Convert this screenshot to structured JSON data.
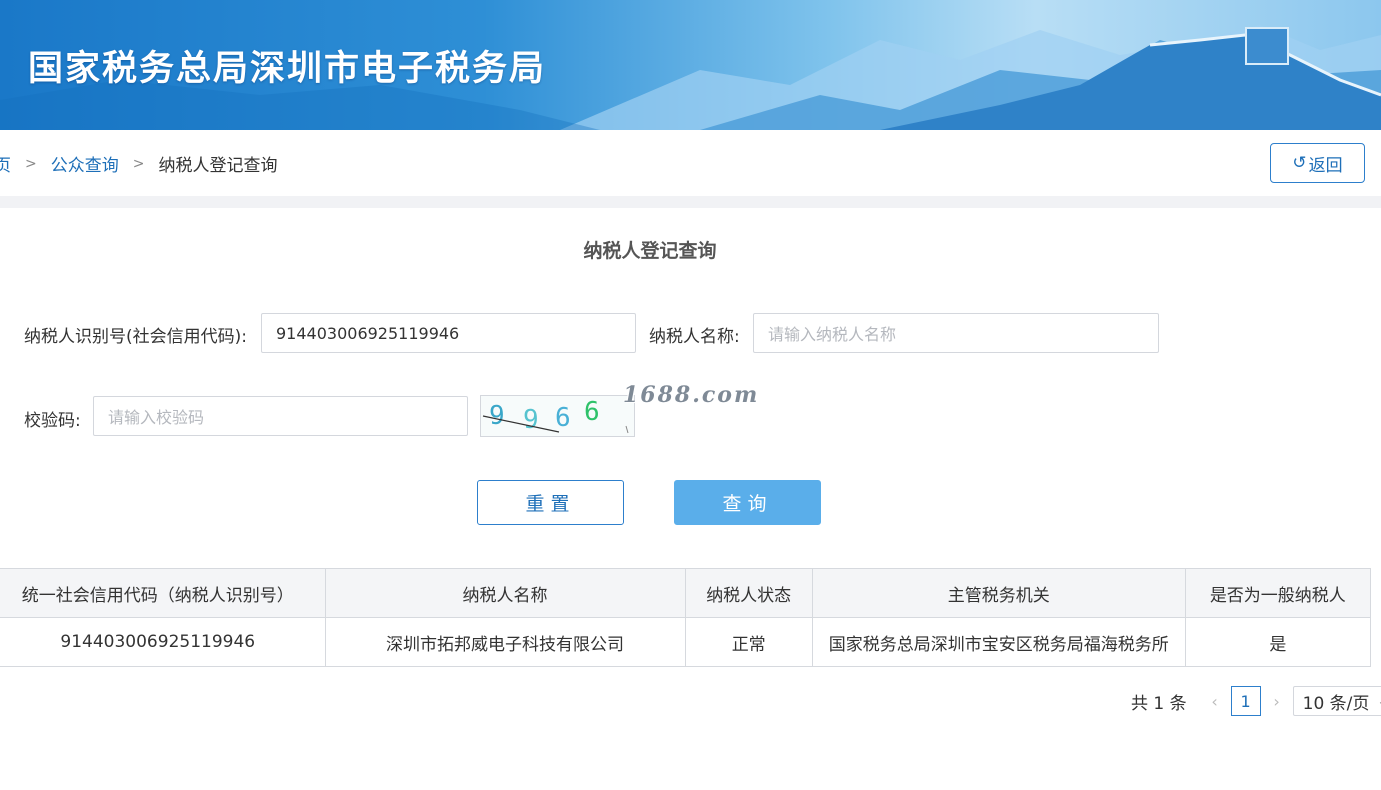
{
  "header": {
    "title": "国家税务总局深圳市电子税务局"
  },
  "breadcrumb": {
    "home": "页",
    "public_query": "公众查询",
    "current": "纳税人登记查询",
    "separator": ">"
  },
  "back_button": {
    "icon": "undo-arrow-icon",
    "icon_glyph": "↺",
    "label": "返回"
  },
  "form": {
    "title": "纳税人登记查询",
    "taxpayer_id_label": "纳税人识别号(社会信用代码):",
    "taxpayer_id_value": "914403006925119946",
    "taxpayer_name_label": "纳税人名称:",
    "taxpayer_name_placeholder": "请输入纳税人名称",
    "captcha_label": "校验码:",
    "captcha_placeholder": "请输入校验码",
    "captcha_text": "9966",
    "watermark": "1688.com",
    "reset_label": "重置",
    "search_label": "查询"
  },
  "table": {
    "columns": [
      "统一社会信用代码（纳税人识别号）",
      "纳税人名称",
      "纳税人状态",
      "主管税务机关",
      "是否为一般纳税人"
    ],
    "rows": [
      [
        "914403006925119946",
        "深圳市拓邦威电子科技有限公司",
        "正常",
        "国家税务总局深圳市宝安区税务局福海税务所",
        "是"
      ]
    ]
  },
  "pagination": {
    "total": "共 1 条",
    "current_page": "1",
    "page_size": "10 条/页",
    "prev_icon": "chevron-left-icon",
    "next_icon": "chevron-right-icon"
  },
  "colors": {
    "brand_blue": "#1e6fb8",
    "search_button": "#5aaeea",
    "border": "#d4d7dd"
  }
}
